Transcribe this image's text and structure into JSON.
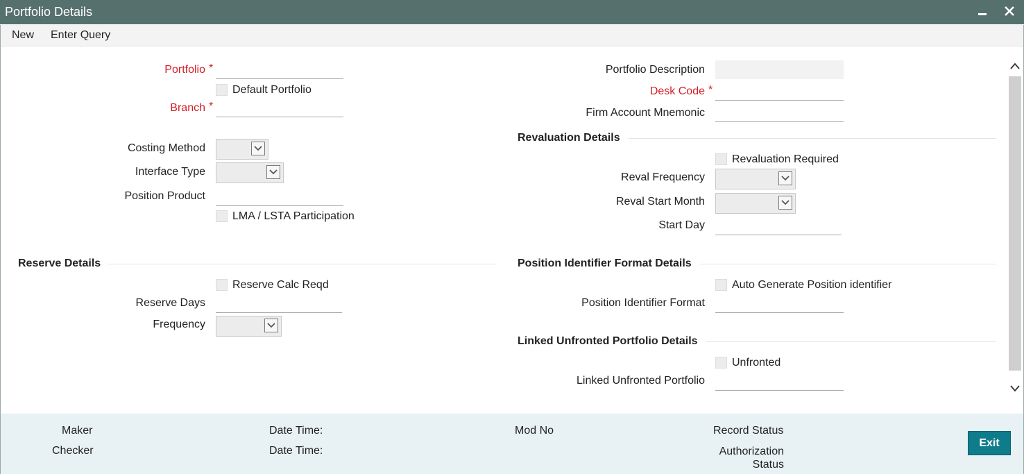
{
  "window": {
    "title": "Portfolio Details",
    "minimize_glyph": "−",
    "close_glyph": "✕"
  },
  "menu": {
    "new_label": "New",
    "enter_query_label": "Enter Query"
  },
  "left": {
    "portfolio_label": "Portfolio",
    "default_portfolio_label": "Default Portfolio",
    "branch_label": "Branch",
    "costing_method_label": "Costing Method",
    "interface_type_label": "Interface Type",
    "position_product_label": "Position Product",
    "lma_label": "LMA / LSTA Participation"
  },
  "right": {
    "portfolio_description_label": "Portfolio Description",
    "desk_code_label": "Desk Code",
    "firm_account_label": "Firm Account Mnemonic"
  },
  "revaluation": {
    "heading": "Revaluation Details",
    "required_label": "Revaluation Required",
    "frequency_label": "Reval Frequency",
    "start_month_label": "Reval Start Month",
    "start_day_label": "Start Day"
  },
  "reserve": {
    "heading": "Reserve Details",
    "calc_label": "Reserve Calc Reqd",
    "days_label": "Reserve Days",
    "frequency_label": "Frequency"
  },
  "position_identifier": {
    "heading": "Position Identifier Format Details",
    "auto_label": "Auto Generate Position identifier",
    "format_label": "Position Identifier Format"
  },
  "linked": {
    "heading": "Linked Unfronted Portfolio Details",
    "unfronted_label": "Unfronted",
    "portfolio_label": "Linked Unfronted Portfolio"
  },
  "required_marker": "*",
  "footer": {
    "maker": "Maker",
    "checker": "Checker",
    "date_time_1": "Date Time:",
    "date_time_2": "Date Time:",
    "mod_no": "Mod No",
    "record_status": "Record Status",
    "auth_status_line1": "Authorization",
    "auth_status_line2": "Status",
    "exit_label": "Exit"
  },
  "colors": {
    "titlebar": "#56706e",
    "required": "#d41e28",
    "exit_button": "#0e7c8a",
    "footer_bg": "#e8f2f4"
  }
}
